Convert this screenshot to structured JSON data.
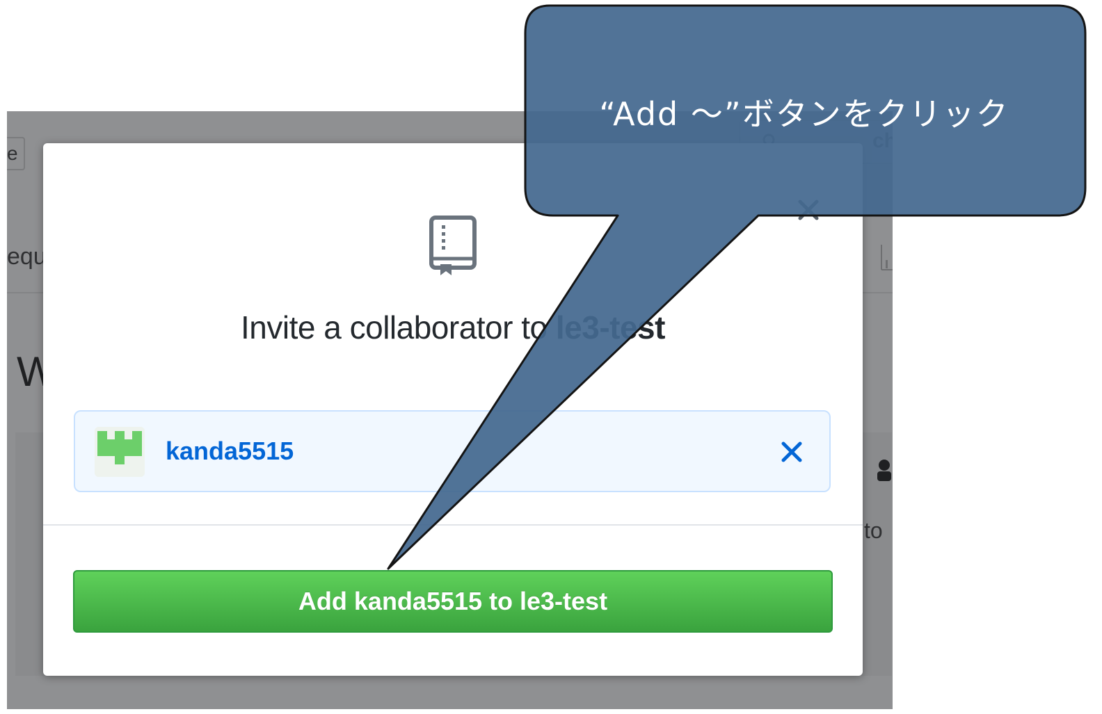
{
  "background": {
    "fragment_e": "e",
    "fragment_equ": "equ",
    "fragment_W": "W",
    "fragment_to": "to",
    "search_label": "ch"
  },
  "modal": {
    "icon": "repo-icon",
    "title_prefix": "Invite a collaborator to ",
    "repo_name": "le3-test",
    "selected_user": {
      "username": "kanda5515",
      "avatar": "identicon-avatar"
    },
    "add_button_label": "Add kanda5515 to le3-test",
    "close_icon": "close-icon",
    "remove_icon": "remove-icon"
  },
  "annotation": {
    "text": "“Add ～”ボタンをクリック",
    "fill_color": "#44688f",
    "border_color": "#1a1a1a"
  },
  "colors": {
    "accent_blue": "#0366d6",
    "button_green": "#4cbb4a",
    "overlay_gray": "#8f9092"
  }
}
